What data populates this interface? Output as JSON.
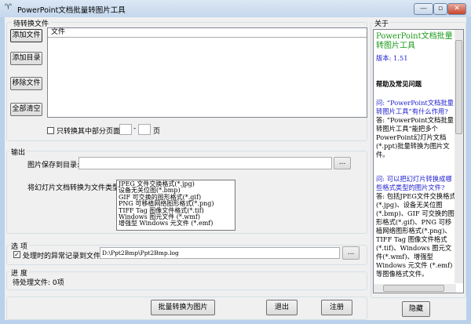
{
  "window": {
    "title": "PowerPoint文档批量转图片工具",
    "minimize": "—",
    "maximize": "▫",
    "close": "✕"
  },
  "files_group": {
    "label": "待转换文件",
    "buttons": [
      "添加文件",
      "添加目录",
      "移除文件",
      "全部清空"
    ],
    "column_header": "文件",
    "partial_label": "只转换其中部分页面:",
    "page_from": "",
    "dash": "-",
    "page_to": "",
    "page_suffix": "页",
    "partial_checked": false
  },
  "output_group": {
    "label": "输出",
    "save_dir_label": "图片保存到目录:",
    "save_dir_value": "",
    "browse": "...",
    "type_label": "将幻灯片文档转换为文件类型:",
    "types": [
      "JPEG 文件交换格式(*.jpg)",
      "设备无关位图(*.bmp)",
      "GIF 可交换的图形格式(*.gif)",
      "PNG 可移植网络图形格式(*.png)",
      "TIFF Tag 图像文件格式(*.tif)",
      "Windows 图元文件 (*.wmf)",
      "增强型 Windows 元文件 (*.emf)"
    ]
  },
  "options_group": {
    "label": "选 项",
    "log_label": "处理时的异常记录到文件:",
    "log_checked": true,
    "log_path": "D:\\Ppt2Bmp\\Ppt2Bmp.log",
    "browse": "..."
  },
  "progress_group": {
    "label": "进 度",
    "status": "待处理文件: 0项"
  },
  "actions": {
    "convert": "批量转换为图片",
    "exit": "退出",
    "register": "注册"
  },
  "about": {
    "label": "关于",
    "app_name": "PowerPoint文档批量转图片工具",
    "version": "版本: 1.51",
    "help_title": "帮助及常见问题",
    "q1": "问: “PowerPoint文档批量转图片工具”有什么作用?",
    "a1": "答: “PowerPoint文档批量转图片工具”能把多个PowerPoint幻灯片文档(*.ppt)批量转换为图片文件。",
    "q2": "问: 可以把幻灯片转换成哪些格式类型的图片文件?",
    "a2": "答: 包括JPEG文件交换格式(*.jpg)、设备无关位图(*.bmp)、GIF 可交换的图形格式(*.gif)、PNG 可移植网络图形格式(*.png)、TIFF Tag 图像文件格式(*.tif)、Windows 图元文件(*.wmf)、增强型Windows 元文件 (*.emf)等图像格式文件。",
    "hide": "隐藏"
  },
  "colors": {
    "app_name": "#1a9a1a",
    "link": "#2020d0"
  }
}
